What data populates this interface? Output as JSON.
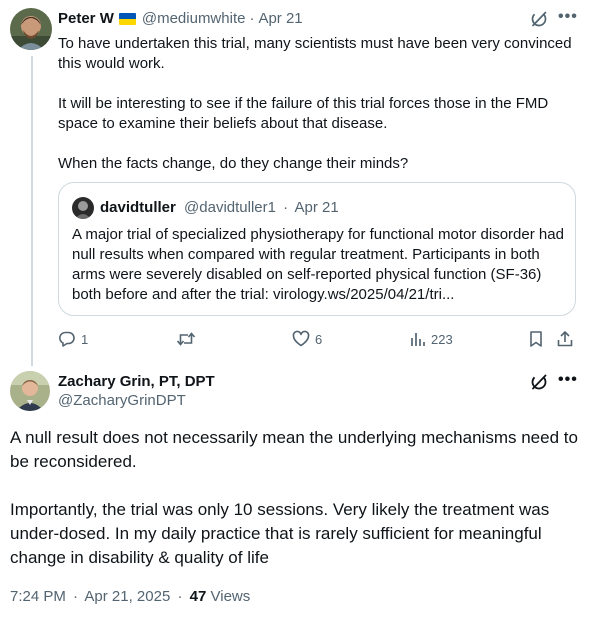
{
  "tweet1": {
    "author_name": "Peter W",
    "handle": "@mediumwhite",
    "separator": "·",
    "date": "Apr 21",
    "paragraphs": [
      "To have undertaken this trial, many scientists must have been very convinced this would work.",
      "It will be interesting to see if the failure of this trial forces those in the FMD space to examine their beliefs about that disease.",
      "When the facts change, do they change their minds?"
    ],
    "flag_colors": [
      "#0057b7",
      "#ffd700"
    ]
  },
  "quote": {
    "author_name": "davidtuller",
    "handle": "@davidtuller1",
    "separator": "·",
    "date": "Apr 21",
    "text": "A major trial of specialized physiotherapy for functional motor disorder had null results when compared with regular treatment. Participants in both arms were severely disabled on self-reported physical function (SF-36) both before and after the trial: virology.ws/2025/04/21/tri..."
  },
  "actions": {
    "reply_count": "1",
    "repost_count": "",
    "like_count": "6",
    "views_count": "223"
  },
  "tweet2": {
    "author_name": "Zachary Grin, PT, DPT",
    "handle": "@ZacharyGrinDPT",
    "paragraphs": [
      "A null result does not necessarily mean the underlying mechanisms need to be reconsidered.",
      "Importantly, the trial was only 10 sessions. Very likely the treatment was under-dosed. In my daily practice that is rarely sufficient for meaningful change in disability & quality of life"
    ],
    "time": "7:24 PM",
    "separator": "·",
    "date": "Apr 21, 2025",
    "separator2": "·",
    "views_count": "47",
    "views_label": "Views"
  },
  "icons": {
    "more": "more-horizontal-icon",
    "grok": "grok-icon",
    "reply": "reply-icon",
    "repost": "repost-icon",
    "like": "heart-icon",
    "views": "views-chart-icon",
    "bookmark": "bookmark-icon",
    "share": "share-icon"
  },
  "colors": {
    "text": "#0f1419",
    "muted": "#536471",
    "border": "#cfd9de"
  }
}
